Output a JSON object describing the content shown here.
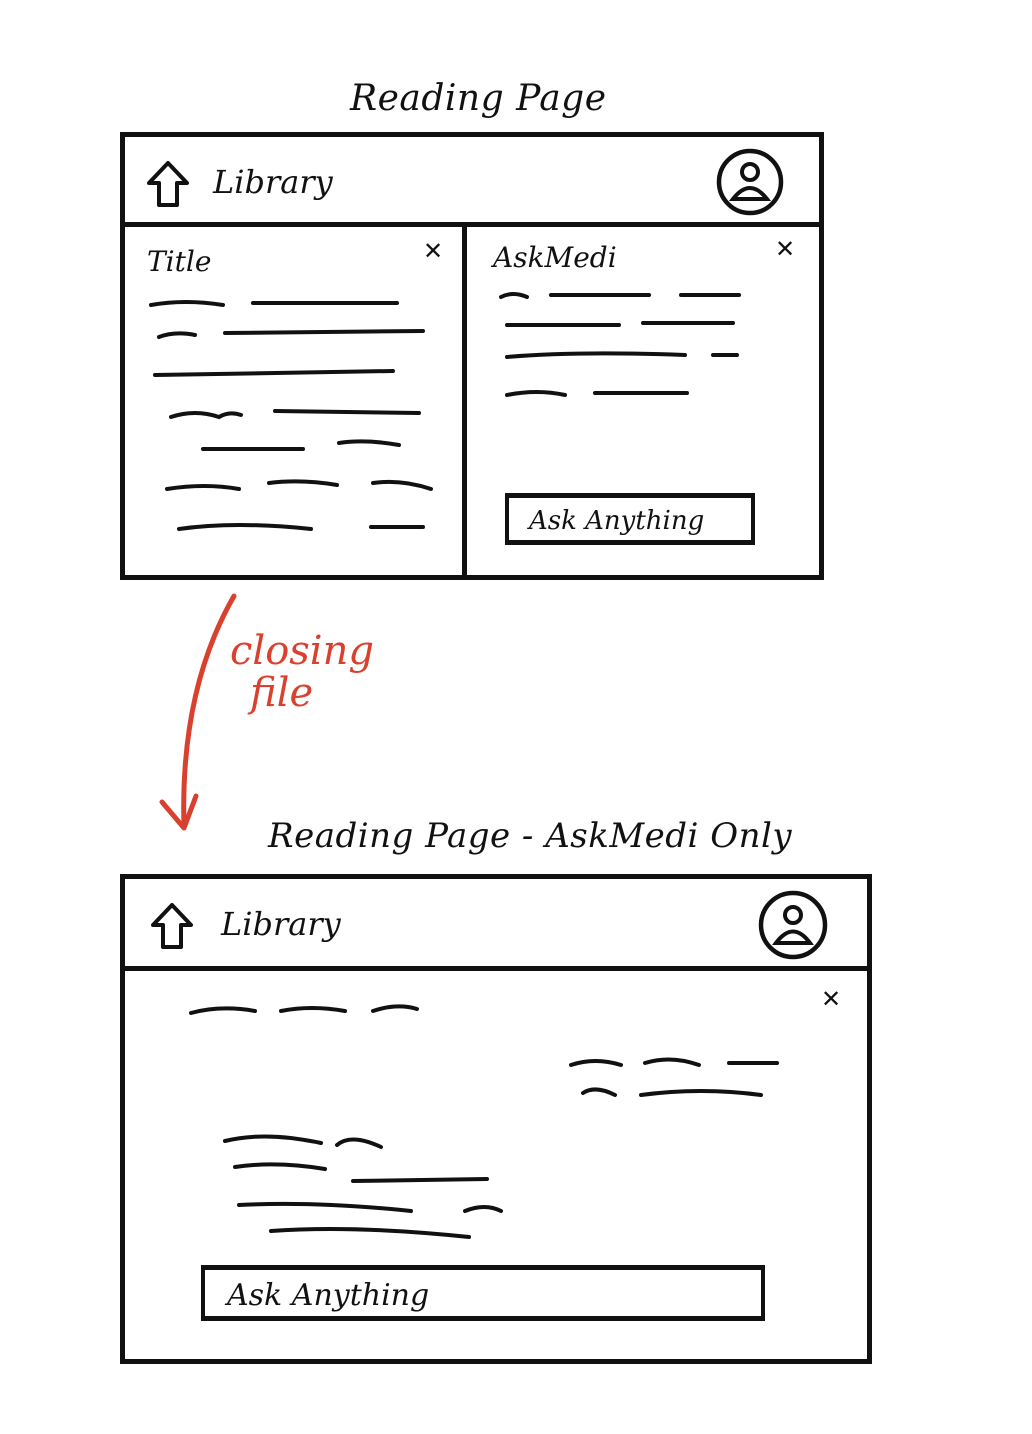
{
  "diagram": {
    "top_frame": {
      "caption": "Reading Page",
      "header": {
        "home_label": "Library",
        "home_icon": "home-icon",
        "avatar_icon": "user-avatar-icon"
      },
      "reader_pane": {
        "title": "Title",
        "close_icon": "close-icon"
      },
      "assistant_pane": {
        "title": "AskMedi",
        "close_icon": "close-icon",
        "input_placeholder": "Ask Anything"
      }
    },
    "transition": {
      "label_line1": "closing",
      "label_line2": "file",
      "color": "#d9412e"
    },
    "bottom_frame": {
      "caption": "Reading Page - AskMedi Only",
      "header": {
        "home_label": "Library",
        "home_icon": "home-icon",
        "avatar_icon": "user-avatar-icon"
      },
      "assistant_pane": {
        "close_icon": "close-icon",
        "input_placeholder": "Ask Anything"
      }
    }
  }
}
